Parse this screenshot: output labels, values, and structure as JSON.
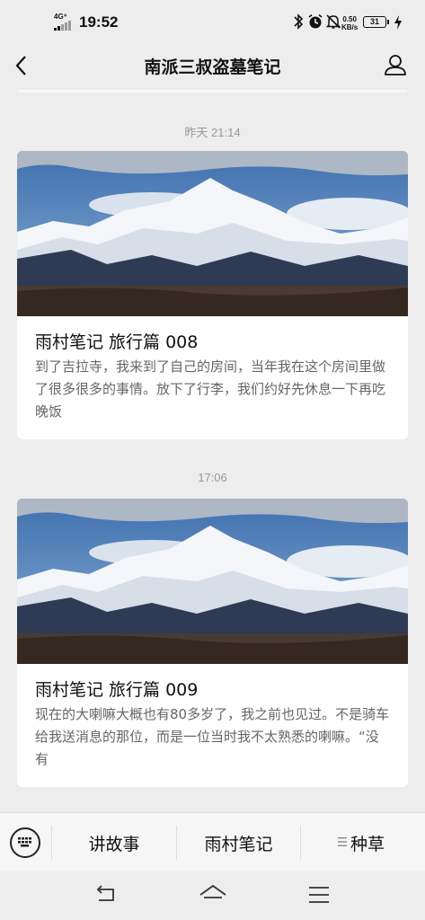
{
  "status_bar": {
    "network": "4G⁺",
    "time": "19:52",
    "speed_value": "0.50",
    "speed_unit": "KB/s",
    "battery": "31"
  },
  "header": {
    "title": "南派三叔盗墓笔记"
  },
  "feed": [
    {
      "timestamp": "昨天 21:14",
      "title": "雨村笔记 旅行篇 008",
      "description": "到了吉拉寺，我来到了自己的房间，当年我在这个房间里做了很多很多的事情。放下了行李，我们约好先休息一下再吃晚饭"
    },
    {
      "timestamp": "17:06",
      "title": "雨村笔记 旅行篇 009",
      "description": "现在的大喇嘛大概也有80多岁了，我之前也见过。不是骑车给我送消息的那位，而是一位当时我不太熟悉的喇嘛。“没有"
    }
  ],
  "menu": {
    "items": [
      "讲故事",
      "雨村笔记",
      "种草"
    ]
  },
  "colors": {
    "background": "#ededed",
    "card": "#ffffff",
    "timestamp": "#999999",
    "description": "#666666"
  },
  "icons": {
    "back": "chevron-left-icon",
    "profile": "person-icon",
    "keyboard": "keyboard-icon",
    "menu_list": "list-icon",
    "nav_back": "back-arrow-icon",
    "nav_home": "home-icon",
    "nav_menu": "hamburger-icon"
  }
}
